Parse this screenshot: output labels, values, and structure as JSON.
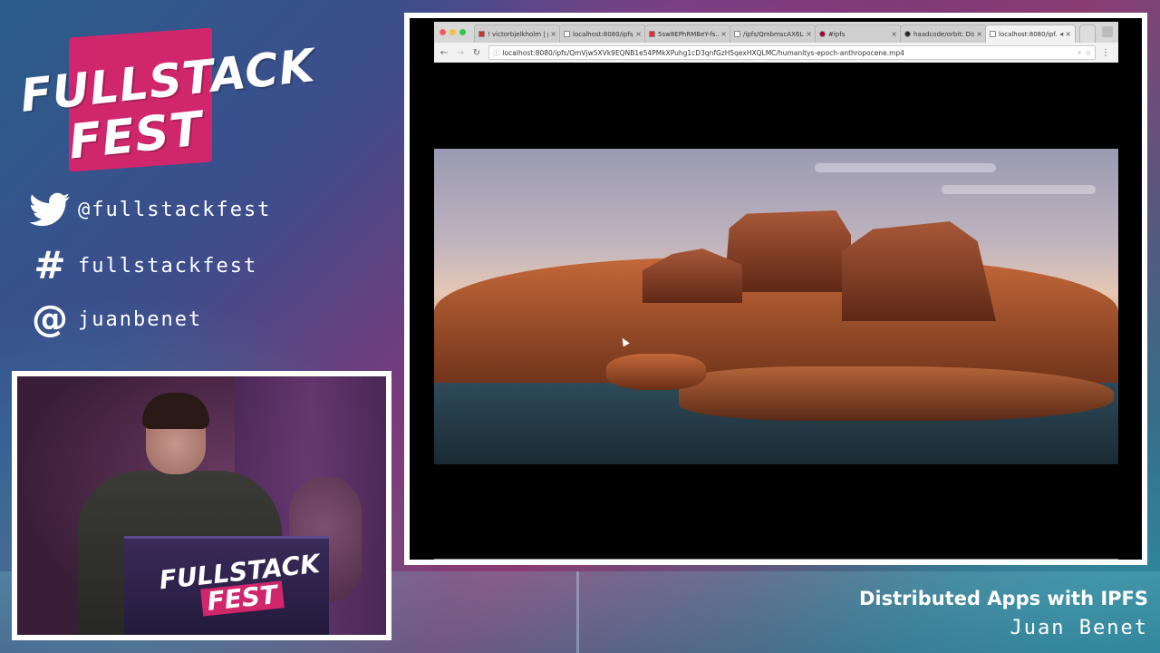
{
  "event": {
    "logo_line1": "FULLSTACK",
    "logo_line2": "FEST"
  },
  "social": {
    "twitter": "@fullstackfest",
    "hashtag": "fullstackfest",
    "at_handle": "juanbenet"
  },
  "podium": {
    "line1": "FULLSTACK",
    "line2": "FEST"
  },
  "browser": {
    "tabs": [
      {
        "label": "! victorbjelkholm | pa",
        "active": false
      },
      {
        "label": "localhost:8080/ipfs/...",
        "active": false
      },
      {
        "label": "5sw8EPhRMBeY-fs...",
        "active": false
      },
      {
        "label": "/ipfs/QmbmscAX6Lx...",
        "active": false
      },
      {
        "label": "#ipfs",
        "active": false
      },
      {
        "label": "haadcode/orbit: Dist...",
        "active": false
      },
      {
        "label": "localhost:8080/ipf...",
        "active": true
      }
    ],
    "url": "localhost:8080/ipfs/QmVjw5XVk9EQNB1e54PMkXPuhg1cD3qnfGzH5qexHXQLMC/humanitys-epoch-anthropocene.mp4"
  },
  "talk": {
    "title": "Distributed Apps with IPFS",
    "speaker": "Juan Benet"
  },
  "colors": {
    "brand_pink": "#d0276c",
    "background_teal": "#2a7d94",
    "background_purple": "#7a3a7a"
  }
}
